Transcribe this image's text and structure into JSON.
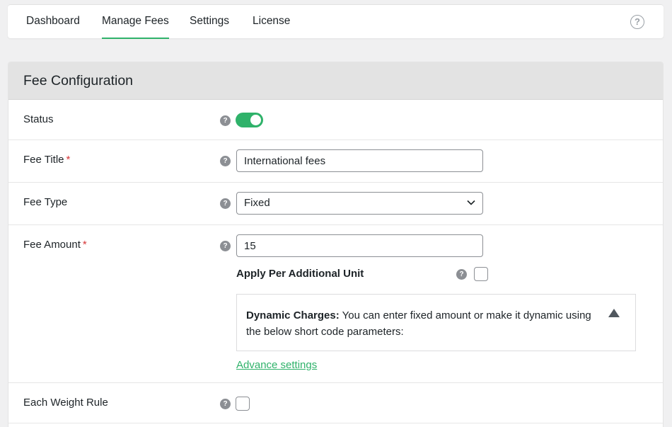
{
  "nav": {
    "tabs": [
      {
        "label": "Dashboard"
      },
      {
        "label": "Manage Fees"
      },
      {
        "label": "Settings"
      },
      {
        "label": "License"
      }
    ],
    "active_tab": "Manage Fees",
    "help_glyph": "?"
  },
  "card": {
    "title": "Fee Configuration"
  },
  "form": {
    "status": {
      "label": "Status",
      "enabled": true
    },
    "fee_title": {
      "label": "Fee Title",
      "required_mark": "*",
      "value": "International fees"
    },
    "fee_type": {
      "label": "Fee Type",
      "selected": "Fixed"
    },
    "fee_amount": {
      "label": "Fee Amount",
      "required_mark": "*",
      "value": "15"
    },
    "apply_per_unit": {
      "label": "Apply Per Additional Unit",
      "checked": false
    },
    "dynamic_charges": {
      "heading": "Dynamic Charges:",
      "text": " You can enter fixed amount or make it dynamic using the below short code parameters:"
    },
    "advance_link": "Advance settings",
    "each_weight_rule": {
      "label": "Each Weight Rule",
      "checked": false
    }
  },
  "icons": {
    "help_tip": "question-mark-icon",
    "select_arrow": "chevron-down-icon",
    "collapse": "triangle-up-icon"
  },
  "colors": {
    "accent": "#2fb26a",
    "required": "#d63638",
    "header_bg": "#e3e3e3"
  }
}
